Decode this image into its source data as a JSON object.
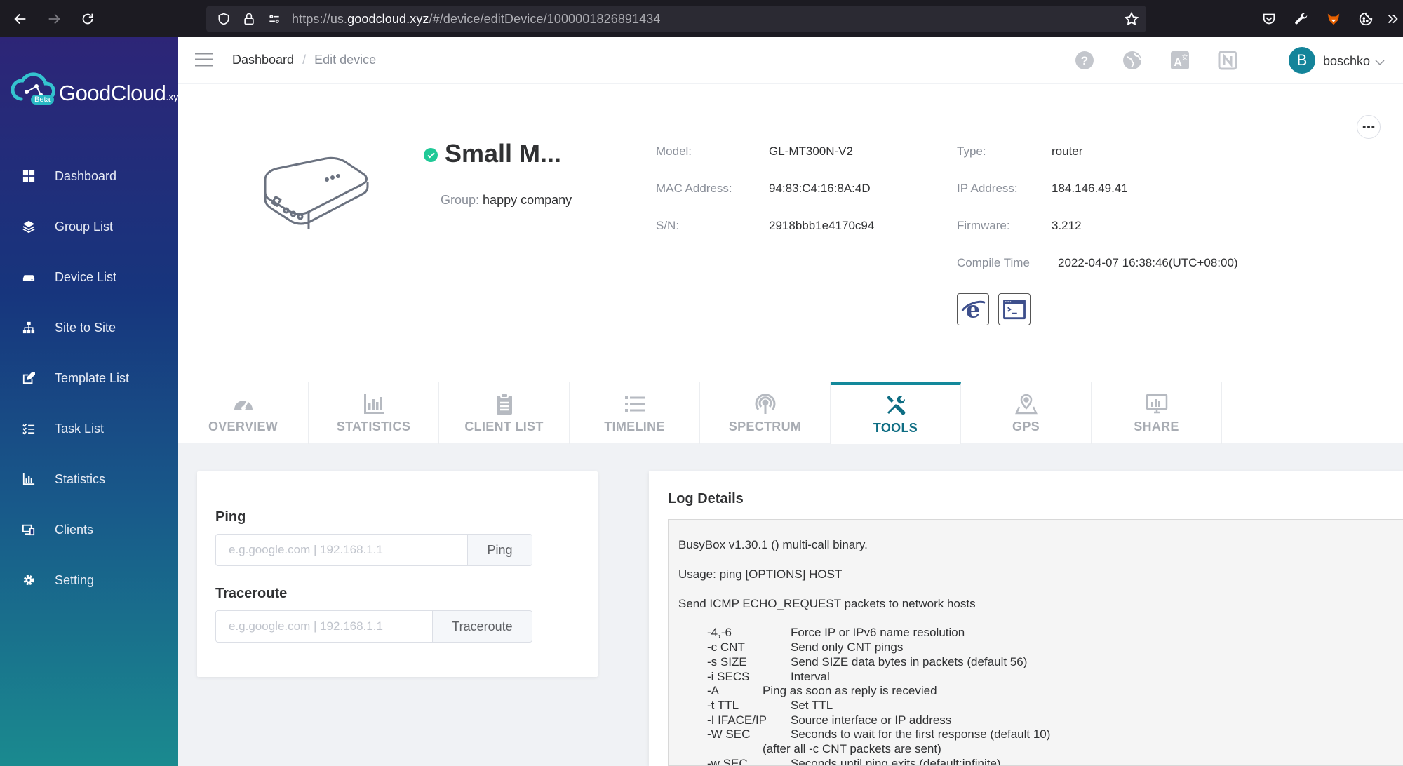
{
  "browser": {
    "url_prefix": "https://us.",
    "url_host": "goodcloud.xyz",
    "url_path": "/#/device/editDevice/1000001826891434"
  },
  "sidebar": {
    "logo_text": "GoodCloud",
    "logo_suffix": ".xyz",
    "beta": "Beta",
    "items": [
      {
        "label": "Dashboard",
        "icon": "grid-icon"
      },
      {
        "label": "Group List",
        "icon": "layers-icon"
      },
      {
        "label": "Device List",
        "icon": "router-icon"
      },
      {
        "label": "Site to Site",
        "icon": "sitemap-icon"
      },
      {
        "label": "Template List",
        "icon": "edit-icon"
      },
      {
        "label": "Task List",
        "icon": "tasks-icon"
      },
      {
        "label": "Statistics",
        "icon": "bar-chart-icon"
      },
      {
        "label": "Clients",
        "icon": "devices-icon"
      },
      {
        "label": "Setting",
        "icon": "gear-icon"
      }
    ]
  },
  "header": {
    "breadcrumb_home": "Dashboard",
    "breadcrumb_sep": "/",
    "breadcrumb_current": "Edit device",
    "user_initial": "B",
    "username": "boschko"
  },
  "device": {
    "name": "Small M...",
    "group_label": "Group:",
    "group_value": "happy company",
    "model_label": "Model:",
    "model_value": "GL-MT300N-V2",
    "mac_label": "MAC Address:",
    "mac_value": "94:83:C4:16:8A:4D",
    "sn_label": "S/N:",
    "sn_value": "2918bbb1e4170c94",
    "type_label": "Type:",
    "type_value": "router",
    "ip_label": "IP Address:",
    "ip_value": "184.146.49.41",
    "firmware_label": "Firmware:",
    "firmware_value": "3.212",
    "compile_label": "Compile Time",
    "compile_value": "2022-04-07 16:38:46(UTC+08:00)"
  },
  "tabs": [
    {
      "label": "OVERVIEW",
      "icon": "speedometer-icon",
      "active": false
    },
    {
      "label": "STATISTICS",
      "icon": "bar-chart-icon",
      "active": false
    },
    {
      "label": "CLIENT LIST",
      "icon": "clipboard-icon",
      "active": false
    },
    {
      "label": "TIMELINE",
      "icon": "list-icon",
      "active": false
    },
    {
      "label": "SPECTRUM",
      "icon": "broadcast-icon",
      "active": false
    },
    {
      "label": "TOOLS",
      "icon": "tools-icon",
      "active": true
    },
    {
      "label": "GPS",
      "icon": "map-pin-icon",
      "active": false
    },
    {
      "label": "SHARE",
      "icon": "monitor-chart-icon",
      "active": false
    }
  ],
  "tools": {
    "ping_title": "Ping",
    "ping_placeholder": "e.g.google.com | 192.168.1.1",
    "ping_button": "Ping",
    "traceroute_title": "Traceroute",
    "traceroute_placeholder": "e.g.google.com | 192.168.1.1",
    "traceroute_button": "Traceroute"
  },
  "log": {
    "title": "Log Details",
    "lines": [
      "BusyBox v1.30.1 () multi-call binary.",
      "Usage: ping [OPTIONS] HOST",
      "Send ICMP ECHO_REQUEST packets to network hosts",
      "-4,-6",
      "Force IP or IPv6 name resolution",
      "-c CNT",
      "Send only CNT pings",
      "-s SIZE",
      "Send SIZE data bytes in packets (default 56)",
      "-i SECS",
      "Interval",
      "-A",
      "Ping as soon as reply is recevied",
      "-t TTL",
      "Set TTL",
      "-I IFACE/IP",
      "Source interface or IP address",
      "-W SEC",
      "Seconds to wait for the first response (default 10)",
      "(after all -c CNT packets are sent)",
      "-w SEC",
      "Seconds until ping exits (default:infinite)"
    ]
  }
}
